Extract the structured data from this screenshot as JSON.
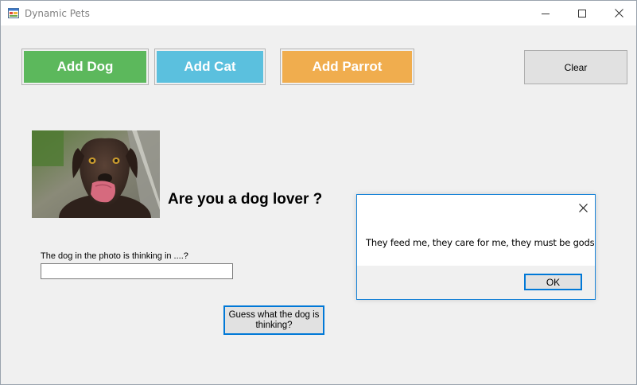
{
  "window": {
    "title": "Dynamic Pets",
    "app_icon": "windows-form-icon",
    "controls": [
      "minimize-icon",
      "maximize-icon",
      "close-icon"
    ]
  },
  "toolbar": {
    "add_dog": {
      "label": "Add Dog",
      "color": "#5cb85c"
    },
    "add_cat": {
      "label": "Add Cat",
      "color": "#5bc0de"
    },
    "add_parrot": {
      "label": "Add Parrot",
      "color": "#f0ad4e"
    },
    "clear": {
      "label": "Clear"
    }
  },
  "main": {
    "photo": "dog-photo",
    "headline": "Are you a dog lover ?",
    "prompt_label": "The dog in the photo is thinking in ....?",
    "answer_value": "",
    "guess_button": "Guess what the dog is thinking?"
  },
  "message_box": {
    "text": "They feed me, they care for me, they must be gods",
    "ok_label": "OK",
    "close_icon": "close-icon"
  },
  "colors": {
    "focus_border": "#0078d7",
    "window_bg": "#f0f0f0"
  }
}
